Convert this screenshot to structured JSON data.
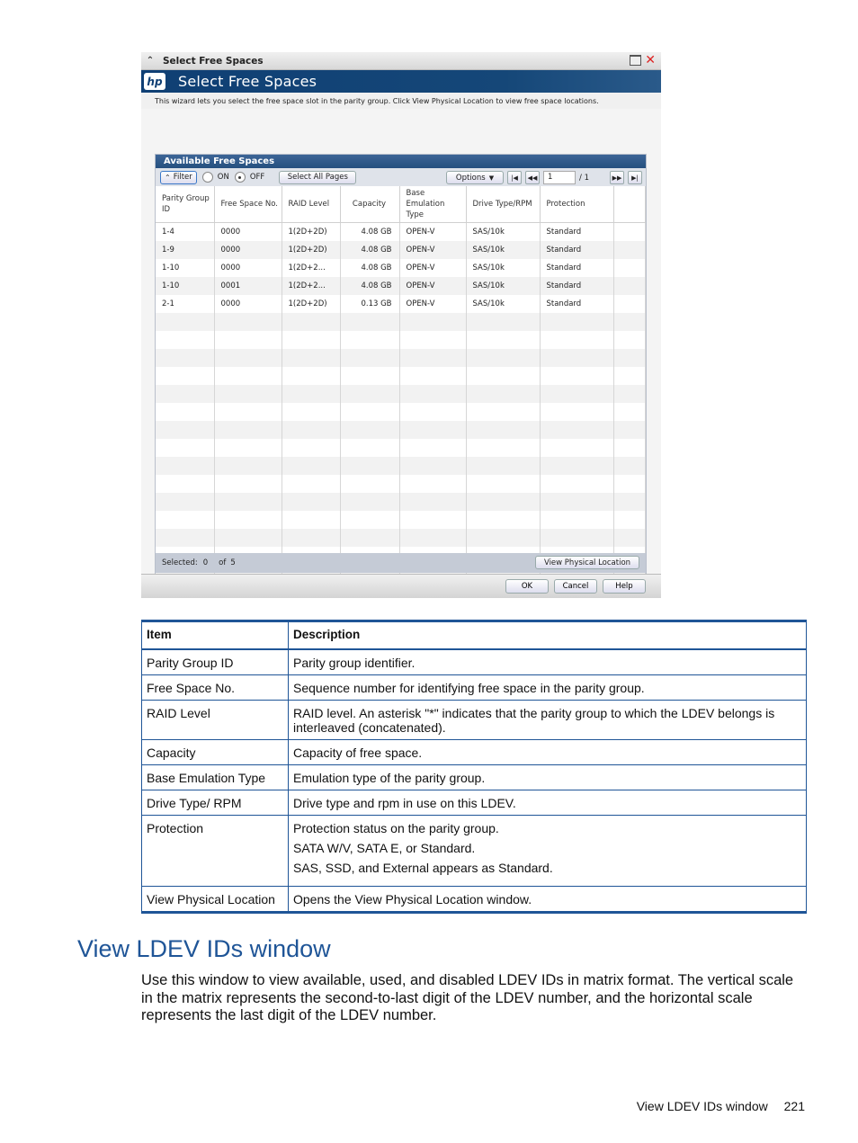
{
  "dialog": {
    "window_title": "Select Free Spaces",
    "banner_title": "Select Free Spaces",
    "logo_text": "hp",
    "description": "This wizard lets you select the free space slot in the parity group. Click View Physical Location to view free space locations.",
    "panel": {
      "title": "Available Free Spaces",
      "toolbar": {
        "filter_label": "Filter",
        "radio_on_label": "ON",
        "radio_off_label": "OFF",
        "filter_state": "OFF",
        "select_all_pages_label": "Select All Pages",
        "options_label": "Options",
        "page_current": "1",
        "page_total": "/ 1"
      },
      "columns": [
        "Parity Group ID",
        "Free Space No.",
        "RAID Level",
        "Capacity",
        "Base Emulation Type",
        "Drive Type/RPM",
        "Protection"
      ],
      "rows": [
        [
          "1-4",
          "0000",
          "1(2D+2D)",
          "4.08 GB",
          "OPEN-V",
          "SAS/10k",
          "Standard"
        ],
        [
          "1-9",
          "0000",
          "1(2D+2D)",
          "4.08 GB",
          "OPEN-V",
          "SAS/10k",
          "Standard"
        ],
        [
          "1-10",
          "0000",
          "1(2D+2...",
          "4.08 GB",
          "OPEN-V",
          "SAS/10k",
          "Standard"
        ],
        [
          "1-10",
          "0001",
          "1(2D+2...",
          "4.08 GB",
          "OPEN-V",
          "SAS/10k",
          "Standard"
        ],
        [
          "2-1",
          "0000",
          "1(2D+2D)",
          "0.13 GB",
          "OPEN-V",
          "SAS/10k",
          "Standard"
        ]
      ],
      "selected_label": "Selected:",
      "selected_count": "0",
      "of_label": "of",
      "total_count": "5",
      "view_physical_location_label": "View Physical Location"
    },
    "buttons": {
      "ok": "OK",
      "cancel": "Cancel",
      "help": "Help"
    }
  },
  "doc_table": {
    "headers": {
      "item": "Item",
      "description": "Description"
    },
    "rows": [
      {
        "item": "Parity Group ID",
        "description": [
          "Parity group identifier."
        ]
      },
      {
        "item": "Free Space No.",
        "description": [
          "Sequence number for identifying free space in the parity group."
        ]
      },
      {
        "item": "RAID Level",
        "description": [
          "RAID level. An asterisk \"*\" indicates that the parity group to which the LDEV belongs is interleaved (concatenated)."
        ]
      },
      {
        "item": "Capacity",
        "description": [
          "Capacity of free space."
        ]
      },
      {
        "item": "Base Emulation Type",
        "description": [
          "Emulation type of the parity group."
        ]
      },
      {
        "item": "Drive Type/ RPM",
        "description": [
          "Drive type and rpm in use on this LDEV."
        ]
      },
      {
        "item": "Protection",
        "description": [
          "Protection status on the parity group.",
          "SATA W/V, SATA E, or Standard.",
          "SAS, SSD, and External appears as Standard."
        ]
      },
      {
        "item": "View Physical Location",
        "description": [
          "Opens the View Physical Location window."
        ]
      }
    ]
  },
  "section": {
    "title": "View LDEV IDs window",
    "body": "Use this window to view available, used, and disabled LDEV IDs in matrix format. The vertical scale in the matrix represents the second-to-last digit of the LDEV number, and the horizontal scale represents the last digit of the LDEV number."
  },
  "footer": {
    "running_title": "View LDEV IDs window",
    "page_number": "221"
  },
  "colors": {
    "hp_blue": "#1f5597",
    "banner": "#0f3f74",
    "panel_header": "#2e5a8c"
  }
}
